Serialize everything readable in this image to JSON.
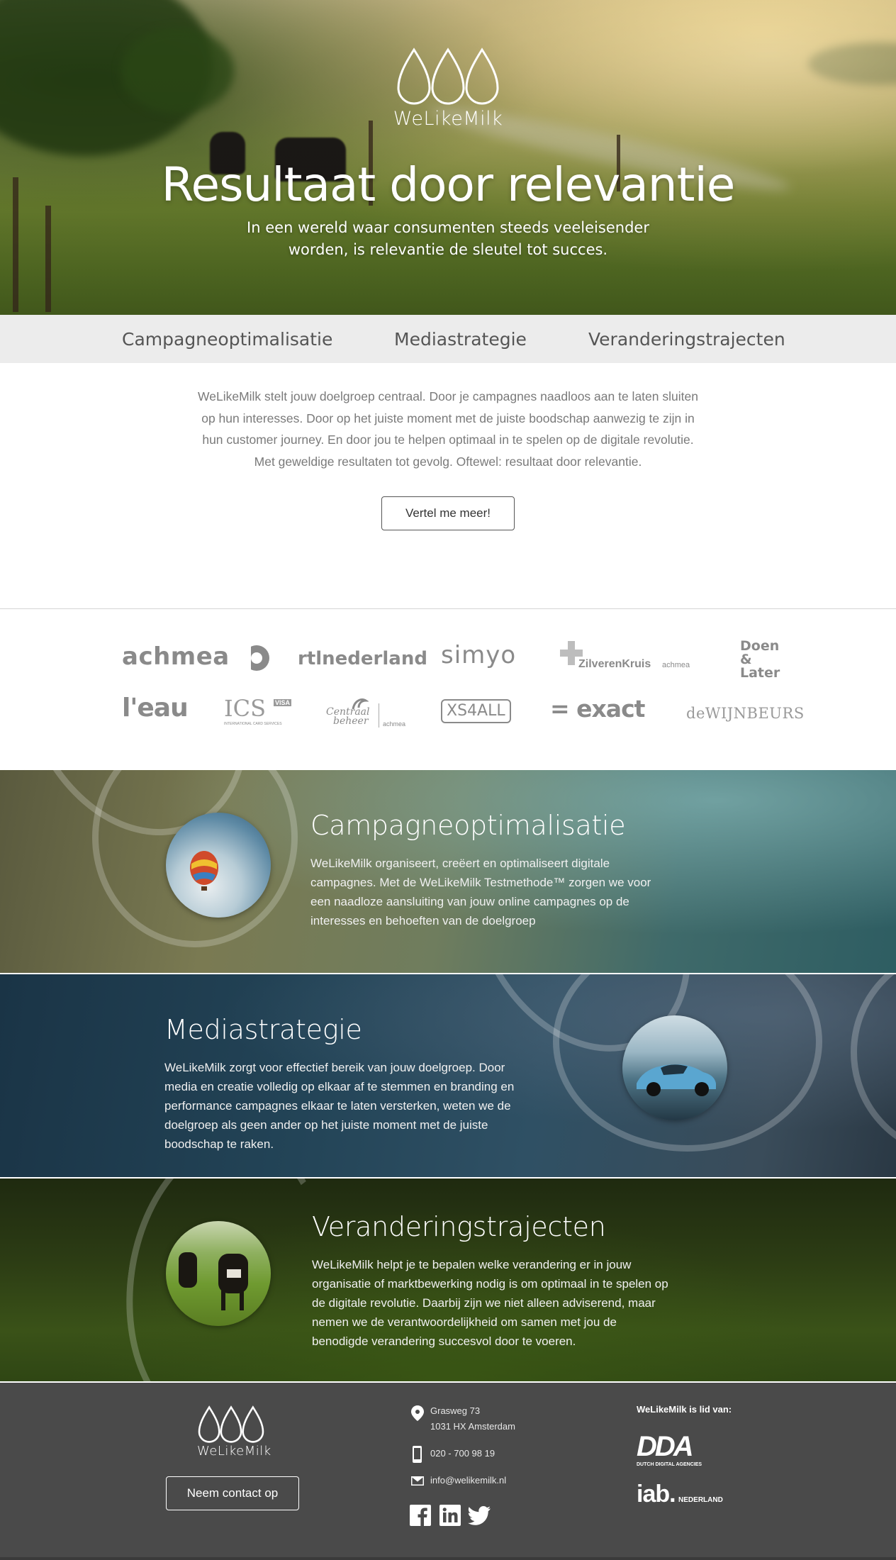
{
  "brand": {
    "name": "WeLikeMilk"
  },
  "hero": {
    "title": "Resultaat door relevantie",
    "subtitle": "In een wereld waar consumenten steeds veeleisender worden, is relevantie de sleutel tot succes."
  },
  "tabs": [
    {
      "label": "Campagneoptimalisatie"
    },
    {
      "label": "Mediastrategie"
    },
    {
      "label": "Veranderingstrajecten"
    }
  ],
  "intro": {
    "text": "WeLikeMilk stelt jouw doelgroep centraal. Door je campagnes naadloos aan te laten sluiten op hun interesses. Door op het juiste moment met de juiste boodschap aanwezig te zijn in hun customer journey. En door jou te helpen optimaal in te spelen op de digitale revolutie. Met geweldige resultaten tot gevolg. Oftewel: resultaat door relevantie.",
    "cta_label": "Vertel me meer!"
  },
  "clients": {
    "achmea": "achmea",
    "rtl": "rtlnederland",
    "simyo": "simyo",
    "zilverenkruis": "ZilverenKruis",
    "zilverenkruis_sub": "achmea",
    "doen1": "Doen",
    "doen2": "&",
    "doen3": "Later",
    "leau": "l'eau",
    "ics": "ICS",
    "ics_visa": "VISA",
    "ics_sub": "INTERNATIONAL CARD SERVICES",
    "centraal1": "Centraal",
    "centraal2": "beheer",
    "centraal_sub": "achmea",
    "xs4all": "XS4ALL",
    "exact": "= exact",
    "wijnbeurs": "deWIJNBEURS"
  },
  "features": [
    {
      "title": "Campagneoptimalisatie",
      "text": "WeLikeMilk organiseert, creëert en optimaliseert digitale campagnes. Met de WeLikeMilk Testmethode™ zorgen we voor een naadloze aansluiting van jouw online campagnes op de interesses en behoeften van de doelgroep"
    },
    {
      "title": "Mediastrategie",
      "text": "WeLikeMilk zorgt voor effectief bereik van jouw doelgroep. Door media en creatie volledig op elkaar af te stemmen en branding en performance campagnes elkaar te laten versterken, weten we de doelgroep als geen ander op het juiste moment met de juiste boodschap te raken."
    },
    {
      "title": "Veranderingstrajecten",
      "text": "WeLikeMilk helpt je te bepalen welke verandering er in jouw organisatie of marktbewerking nodig is om optimaal in te spelen op de digitale revolutie. Daarbij zijn we niet alleen adviserend, maar nemen we de verantwoordelijkheid om samen met jou de benodigde verandering succesvol door te voeren."
    }
  ],
  "footer": {
    "contact_label": "Neem contact op",
    "address_line1": "Grasweg 73",
    "address_line2": "1031 HX Amsterdam",
    "phone": "020 - 700 98 19",
    "email": "info@welikemilk.nl",
    "member_title": "WeLikeMilk is lid van:",
    "dda_label": "DDA",
    "dda_sub": "DUTCH DIGITAL AGENCIES",
    "iab_label": "iab.",
    "iab_sub": "NEDERLAND"
  },
  "icons": {
    "location": "location-pin-icon",
    "phone": "mobile-phone-icon",
    "email": "envelope-icon",
    "facebook": "facebook-icon",
    "linkedin": "linkedin-icon",
    "twitter": "twitter-icon"
  },
  "colors": {
    "tab_bar": "#ececec",
    "footer": "#4a4a4a",
    "text_gray": "#7a7a7a"
  }
}
